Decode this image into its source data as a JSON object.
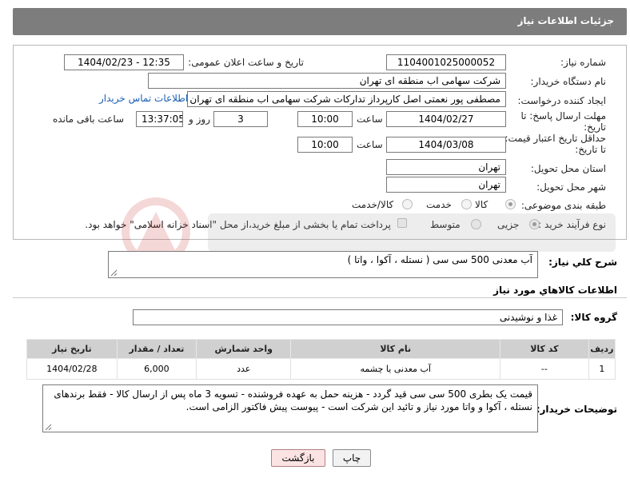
{
  "header": {
    "title": "جزئیات اطلاعات نیاز"
  },
  "form": {
    "need_number": {
      "label": "شماره نیاز:",
      "value": "1104001025000052"
    },
    "announce_datetime": {
      "label": "تاریخ و ساعت اعلان عمومی:",
      "value": "1404/02/23 - 12:35"
    },
    "buyer_org": {
      "label": "نام دستگاه خریدار:",
      "value": "شرکت سهامی اب منطقه ای تهران"
    },
    "requester": {
      "label": "ایجاد کننده درخواست:",
      "value": "مصطفی پور نعمتی اصل کارپرداز تدارکات شرکت سهامی اب منطقه ای تهران",
      "contact_link": "اطلاعات تماس خریدار"
    },
    "reply_deadline": {
      "label_line1": "مهلت ارسال پاسخ: تا",
      "label_line2": "تاریخ:",
      "date": "1404/02/27",
      "time_label": "ساعت",
      "time": "10:00",
      "days": "3",
      "days_label": "روز و",
      "remaining": "13:37:05",
      "remaining_label": "ساعت باقی مانده"
    },
    "price_validity": {
      "label_line1": "حداقل تاریخ اعتبار قیمت:",
      "label_line2": "تا تاریخ:",
      "date": "1404/03/08",
      "time_label": "ساعت",
      "time": "10:00"
    },
    "delivery_province": {
      "label": "استان محل تحویل:",
      "value": "تهران"
    },
    "delivery_city": {
      "label": "شهر محل تحویل:",
      "value": "تهران"
    },
    "category": {
      "label": "طبقه بندی موضوعی:",
      "options": [
        "کالا",
        "خدمت",
        "کالا/خدمت"
      ],
      "selected": "کالا"
    },
    "purchase_type": {
      "label": "نوع فرآیند خرید :",
      "options": [
        "جزیی",
        "متوسط"
      ],
      "selected": "جزیی",
      "payment_note": "پرداخت تمام یا بخشی از مبلغ خرید،از محل \"اسناد خزانه اسلامی\" خواهد بود."
    }
  },
  "description": {
    "label": "شرح کلي نياز:",
    "value": "آب معدنی 500 سی سی ( نستله ، آکوا ، واتا )"
  },
  "goods_info": {
    "title": "اطلاعات کالاهاي مورد نياز",
    "group_label": "گروه کالا:",
    "group_value": "غذا و نوشیدنی"
  },
  "table": {
    "headers": [
      "ردیف",
      "کد کالا",
      "نام کالا",
      "واحد شمارش",
      "تعداد / مقدار",
      "تاریخ نیاز"
    ],
    "rows": [
      [
        "1",
        "--",
        "آب معدنی یا چشمه",
        "عدد",
        "6,000",
        "1404/02/28"
      ]
    ]
  },
  "buyer_notes": {
    "label": "توضیحات خریدار:",
    "value": "قیمت یک بطری 500 سی سی قید گردد - هزینه حمل به عهده فروشنده - تسویه 3  ماه پس از ارسال کالا - فقط برندهای نستله ، آکوا و واتا مورد نیاز و تائید این شرکت است - پیوست پیش فاکتور الزامی است."
  },
  "buttons": {
    "print": "چاپ",
    "back": "بازگشت"
  },
  "colors": {
    "header_bg": "#7d7d7d",
    "link": "#1a5fb4",
    "back_button_bg": "#fbe3e3"
  }
}
